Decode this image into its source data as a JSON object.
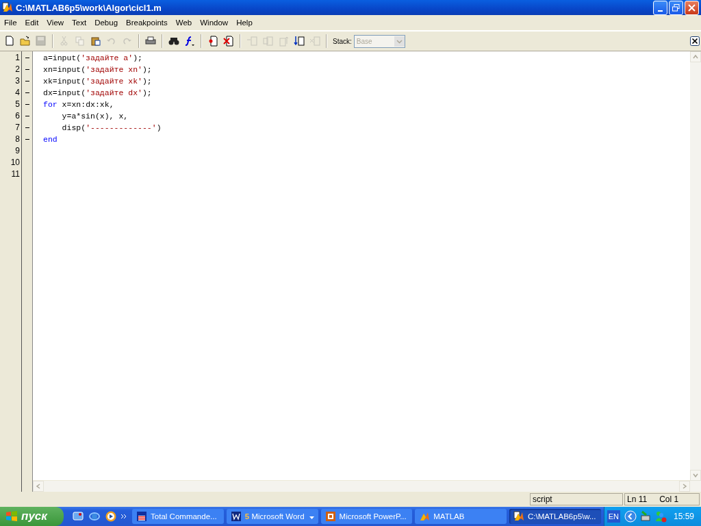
{
  "window": {
    "title": "C:\\MATLAB6p5\\work\\Algor\\cicl1.m"
  },
  "menu": [
    "File",
    "Edit",
    "View",
    "Text",
    "Debug",
    "Breakpoints",
    "Web",
    "Window",
    "Help"
  ],
  "toolbar": {
    "buttons": [
      {
        "kind": "new",
        "disabled": false
      },
      {
        "kind": "open",
        "disabled": false
      },
      {
        "kind": "save",
        "disabled": true
      },
      {
        "kind": "cut",
        "disabled": true
      },
      {
        "kind": "copy",
        "disabled": true
      },
      {
        "kind": "paste",
        "disabled": false
      },
      {
        "kind": "undo",
        "disabled": true
      },
      {
        "kind": "redo",
        "disabled": true
      },
      {
        "kind": "print",
        "disabled": false
      },
      {
        "kind": "find",
        "disabled": false
      },
      {
        "kind": "function",
        "disabled": false
      },
      {
        "kind": "set-breakpoint",
        "disabled": false
      },
      {
        "kind": "clear-breakpoints",
        "disabled": false
      },
      {
        "kind": "step",
        "disabled": true
      },
      {
        "kind": "step-in",
        "disabled": true
      },
      {
        "kind": "step-out",
        "disabled": true
      },
      {
        "kind": "continue",
        "disabled": false
      },
      {
        "kind": "exit-debug",
        "disabled": true
      }
    ],
    "stack_label": "Stack:",
    "stack_value": "Base",
    "stack_disabled": true
  },
  "editor": {
    "lines": [
      {
        "number": "1",
        "executable": true,
        "tokens": [
          {
            "kind": "plain",
            "text": "a=input("
          },
          {
            "kind": "string",
            "text": "'задайте a'"
          },
          {
            "kind": "plain",
            "text": ");"
          }
        ]
      },
      {
        "number": "2",
        "executable": true,
        "tokens": [
          {
            "kind": "plain",
            "text": "xn=input("
          },
          {
            "kind": "string",
            "text": "'задайте xn'"
          },
          {
            "kind": "plain",
            "text": ");"
          }
        ]
      },
      {
        "number": "3",
        "executable": true,
        "tokens": [
          {
            "kind": "plain",
            "text": "xk=input("
          },
          {
            "kind": "string",
            "text": "'задайте xk'"
          },
          {
            "kind": "plain",
            "text": ");"
          }
        ]
      },
      {
        "number": "4",
        "executable": true,
        "tokens": [
          {
            "kind": "plain",
            "text": "dx=input("
          },
          {
            "kind": "string",
            "text": "'задайте dx'"
          },
          {
            "kind": "plain",
            "text": ");"
          }
        ]
      },
      {
        "number": "5",
        "executable": true,
        "tokens": [
          {
            "kind": "keyword",
            "text": "for"
          },
          {
            "kind": "plain",
            "text": " x=xn:dx:xk,"
          }
        ]
      },
      {
        "number": "6",
        "executable": true,
        "tokens": [
          {
            "kind": "plain",
            "text": "    y=a*sin(x), x,"
          }
        ]
      },
      {
        "number": "7",
        "executable": true,
        "tokens": [
          {
            "kind": "plain",
            "text": "    disp("
          },
          {
            "kind": "string",
            "text": "'-------------'"
          },
          {
            "kind": "plain",
            "text": ")"
          }
        ]
      },
      {
        "number": "8",
        "executable": true,
        "tokens": [
          {
            "kind": "keyword",
            "text": "end"
          }
        ]
      },
      {
        "number": "9",
        "executable": false
      },
      {
        "number": "10",
        "executable": false
      },
      {
        "number": "11",
        "executable": false
      }
    ]
  },
  "status_bar": {
    "mode": "script",
    "line": "Ln 11",
    "column": "Col 1"
  },
  "taskbar": {
    "start": "пуск",
    "tasks": [
      {
        "kind": "disk",
        "label": "Total Commande...",
        "group": false,
        "selected": false
      },
      {
        "kind": "word",
        "label": "Microsoft Word",
        "count": "5",
        "group": true,
        "selected": false
      },
      {
        "kind": "slides",
        "label": "Microsoft PowerP...",
        "group": false,
        "selected": false
      },
      {
        "kind": "matlab",
        "label": "MATLAB",
        "group": false,
        "selected": false
      },
      {
        "kind": "matlab-editor",
        "label": "C:\\MATLAB6p5\\w...",
        "group": false,
        "selected": true
      }
    ],
    "language": "EN",
    "clock": "15:59"
  }
}
